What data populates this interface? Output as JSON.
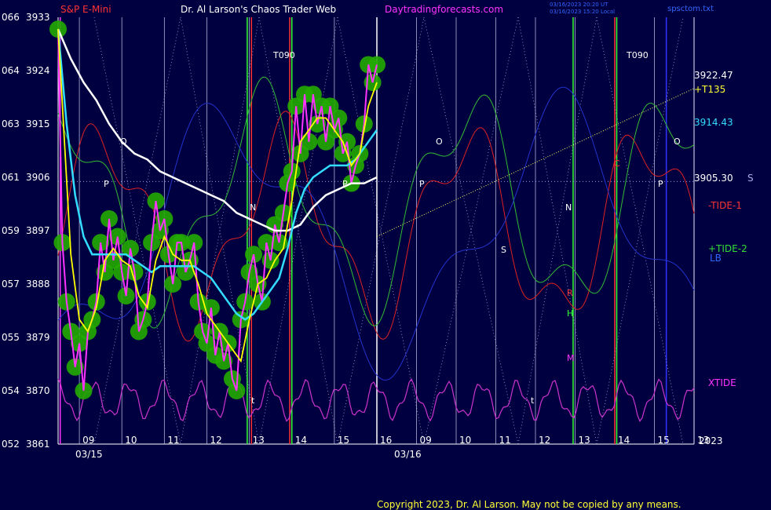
{
  "header": {
    "left_title": "S&P E-Mini",
    "center_title": "Dr. Al Larson's Chaos Trader Web",
    "site": "Daytradingforecasts.com",
    "stamp1": "03/16/2023 20:20 UT",
    "stamp2": "03/16/2023 15:20 Local",
    "file": "spsctom.txt"
  },
  "footer": {
    "copyright": "Copyright 2023, Dr. Al Larson. May not be copied by any means."
  },
  "colors": {
    "background": "#000040",
    "price_dots": "#22aa00",
    "price_line": "#ff33ff",
    "ma_fast": "#ffff00",
    "ma_mid": "#33ddff",
    "ma_slow": "#ffffff",
    "tide1": "#dd2222",
    "tide2": "#33bb33",
    "xtide": "#cc33cc",
    "forecast": "#ffff66"
  },
  "chart_data": {
    "type": "line",
    "ylim": [
      3861,
      3933
    ],
    "y_ticks": [
      3861,
      3870,
      3879,
      3888,
      3897,
      3906,
      3915,
      3924,
      3933
    ],
    "y_tick_left": [
      "052",
      "054",
      "055",
      "057",
      "059",
      "061",
      "063",
      "064",
      "066"
    ],
    "x_ticks_day1": [
      "09",
      "10",
      "11",
      "12",
      "13",
      "14",
      "15",
      "16"
    ],
    "x_ticks_day2": [
      "09",
      "10",
      "11",
      "12",
      "13",
      "14",
      "15",
      "13"
    ],
    "date_labels": [
      "03/15",
      "03/16"
    ],
    "year_label": "2023",
    "right_labels": {
      "level1": "3922.47",
      "level1_name": "+T135",
      "level2": "3914.43",
      "level3": "3905.30",
      "level3_tag": "S",
      "tide1": "-TIDE-1",
      "tide2": "+TIDE-2",
      "lb": "LB",
      "xtide": "XTIDE"
    },
    "annotations": {
      "t090": "T090",
      "O": "O",
      "P": "P",
      "N": "N",
      "S": "S",
      "R": "R",
      "H": "H",
      "M": "M",
      "C": "C",
      "t": "t"
    },
    "price_series": {
      "name": "S&P E-Mini",
      "x_hours": [
        8.5,
        8.6,
        8.7,
        8.8,
        8.9,
        9.0,
        9.1,
        9.2,
        9.3,
        9.4,
        9.5,
        9.6,
        9.7,
        9.8,
        9.9,
        10.0,
        10.1,
        10.2,
        10.3,
        10.4,
        10.5,
        10.6,
        10.7,
        10.8,
        10.9,
        11.0,
        11.1,
        11.2,
        11.3,
        11.4,
        11.5,
        11.6,
        11.7,
        11.8,
        11.9,
        12.0,
        12.1,
        12.2,
        12.3,
        12.4,
        12.5,
        12.6,
        12.7,
        12.8,
        12.9,
        13.0,
        13.1,
        13.2,
        13.3,
        13.4,
        13.5,
        13.6,
        13.7,
        13.8,
        13.9,
        14.0,
        14.1,
        14.2,
        14.3,
        14.4,
        14.5,
        14.6,
        14.7,
        14.8,
        14.9,
        15.0,
        15.1,
        15.2,
        15.3,
        15.4,
        15.5,
        15.6,
        15.7,
        15.8,
        15.9,
        16.0
      ],
      "values": [
        3931,
        3895,
        3885,
        3880,
        3874,
        3878,
        3870,
        3880,
        3882,
        3885,
        3895,
        3890,
        3899,
        3892,
        3896,
        3890,
        3886,
        3894,
        3890,
        3880,
        3882,
        3885,
        3895,
        3902,
        3897,
        3899,
        3893,
        3888,
        3895,
        3895,
        3890,
        3892,
        3895,
        3885,
        3880,
        3878,
        3884,
        3876,
        3880,
        3875,
        3878,
        3872,
        3870,
        3882,
        3885,
        3890,
        3893,
        3888,
        3885,
        3895,
        3892,
        3898,
        3895,
        3900,
        3905,
        3907,
        3918,
        3910,
        3920,
        3912,
        3920,
        3915,
        3918,
        3912,
        3918,
        3914,
        3916,
        3910,
        3912,
        3905,
        3908,
        3910,
        3915,
        3925,
        3922,
        3925
      ]
    },
    "ma_fast": {
      "x_hours": [
        8.5,
        8.8,
        9.0,
        9.2,
        9.4,
        9.6,
        9.8,
        10.0,
        10.2,
        10.4,
        10.6,
        10.8,
        11.0,
        11.2,
        11.4,
        11.6,
        11.8,
        12.0,
        12.2,
        12.4,
        12.6,
        12.8,
        13.0,
        13.2,
        13.4,
        13.6,
        13.8,
        14.0,
        14.2,
        14.4,
        14.6,
        14.8,
        15.0,
        15.2,
        15.4,
        15.6,
        15.8,
        16.0
      ],
      "values": [
        3931,
        3893,
        3882,
        3880,
        3884,
        3892,
        3894,
        3892,
        3891,
        3886,
        3884,
        3892,
        3896,
        3893,
        3892,
        3892,
        3888,
        3883,
        3881,
        3879,
        3877,
        3875,
        3882,
        3888,
        3889,
        3892,
        3894,
        3902,
        3912,
        3914,
        3916,
        3916,
        3914,
        3912,
        3908,
        3910,
        3918,
        3922
      ]
    },
    "ma_mid": {
      "x_hours": [
        8.5,
        8.7,
        8.9,
        9.1,
        9.3,
        9.5,
        9.7,
        9.9,
        10.1,
        10.3,
        10.5,
        10.7,
        10.9,
        11.1,
        11.3,
        11.5,
        11.7,
        11.9,
        12.1,
        12.3,
        12.5,
        12.7,
        12.9,
        13.1,
        13.3,
        13.5,
        13.7,
        13.9,
        14.1,
        14.3,
        14.5,
        14.7,
        14.9,
        15.1,
        15.3,
        15.5,
        15.7,
        16.0
      ],
      "values": [
        3931,
        3915,
        3903,
        3896,
        3893,
        3893,
        3893,
        3893,
        3893,
        3892,
        3891,
        3890,
        3891,
        3891,
        3891,
        3891,
        3891,
        3890,
        3889,
        3887,
        3885,
        3883,
        3882,
        3883,
        3885,
        3887,
        3889,
        3894,
        3900,
        3904,
        3906,
        3907,
        3908,
        3908,
        3908,
        3909,
        3911,
        3914
      ]
    },
    "ma_slow": {
      "x_hours": [
        8.5,
        8.8,
        9.1,
        9.4,
        9.7,
        10.0,
        10.3,
        10.6,
        10.9,
        11.2,
        11.5,
        11.8,
        12.1,
        12.4,
        12.7,
        13.0,
        13.3,
        13.6,
        13.9,
        14.2,
        14.5,
        14.8,
        15.1,
        15.4,
        15.7,
        16.0
      ],
      "values": [
        3931,
        3926,
        3922,
        3919,
        3915,
        3912,
        3910,
        3909,
        3907,
        3906,
        3905,
        3904,
        3903,
        3902,
        3900,
        3899,
        3898,
        3897,
        3897,
        3898,
        3901,
        3903,
        3904,
        3905,
        3905,
        3906
      ]
    },
    "forecast_line": {
      "x": [
        16.0,
        24.0
      ],
      "values": [
        3896,
        3921
      ]
    }
  }
}
